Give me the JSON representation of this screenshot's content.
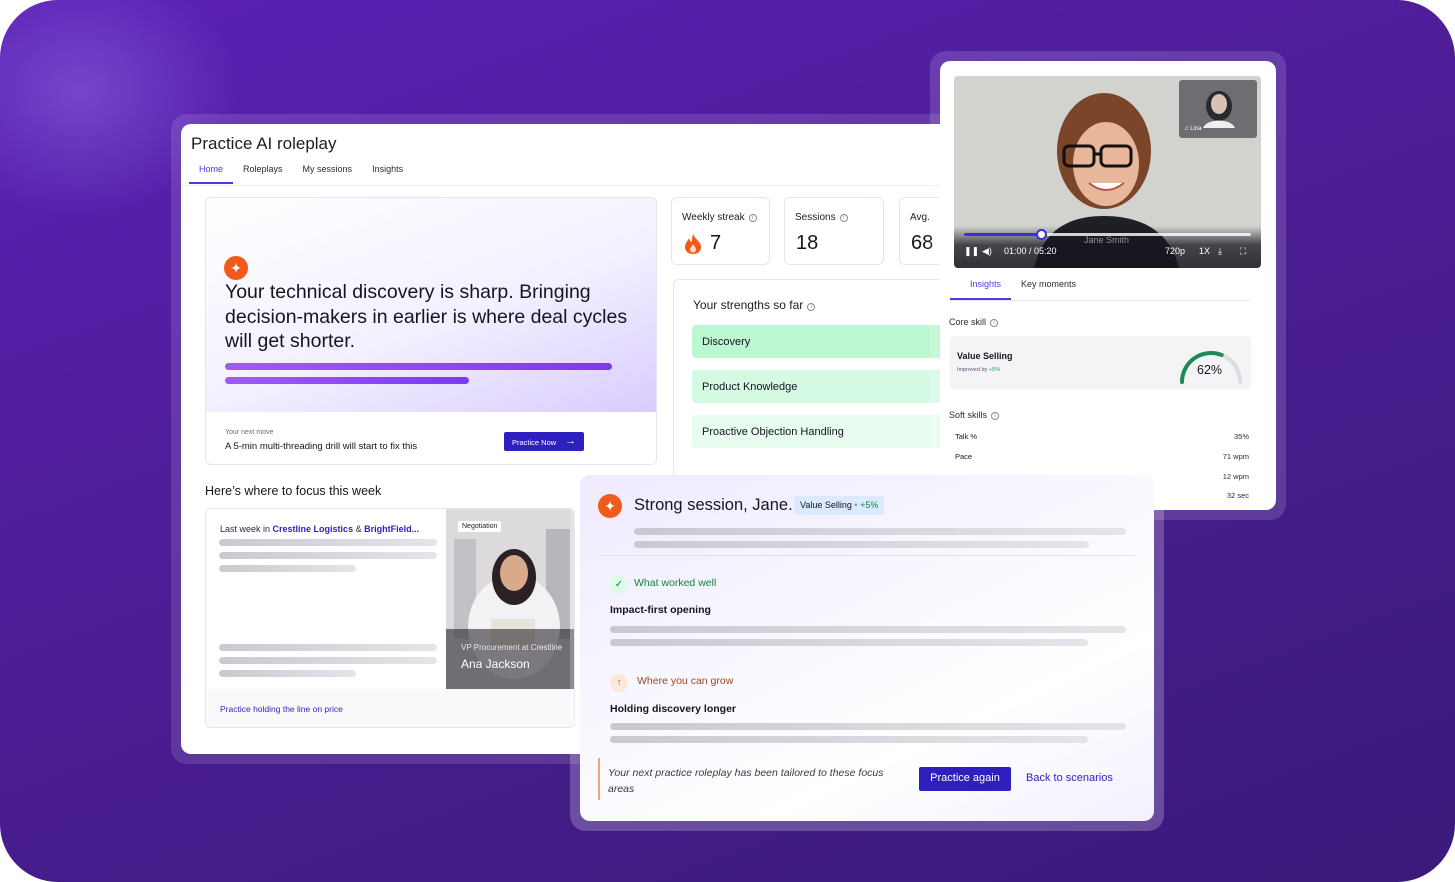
{
  "main": {
    "title": "Practice AI roleplay",
    "tabs": [
      {
        "label": "Home",
        "active": true
      },
      {
        "label": "Roleplays",
        "active": false
      },
      {
        "label": "My sessions",
        "active": false
      },
      {
        "label": "Insights",
        "active": false
      }
    ],
    "hero": {
      "icon": "sparkle-icon",
      "text": "Your technical discovery is sharp. Bringing decision-makers in earlier is where deal cycles will get shorter.",
      "next_label": "Your next move",
      "next_text": "A 5-min multi-threading drill will start to fix this",
      "button": "Practice Now"
    },
    "stats": [
      {
        "label": "Weekly streak",
        "value": "7",
        "icon": "flame-icon"
      },
      {
        "label": "Sessions",
        "value": "18"
      },
      {
        "label": "Avg.",
        "value": "68"
      }
    ],
    "strengths": {
      "title": "Your strengths so far",
      "items": [
        "Discovery",
        "Product Knowledge",
        "Proactive Objection Handling"
      ]
    },
    "focus": {
      "title": "Here’s where to focus this week",
      "last_week_prefix": "Last week in",
      "company_1": "Crestline Logistics",
      "amp": "&",
      "company_2": "BrightField...",
      "link": "Practice holding the line on price",
      "persona_tag": "Negotiation",
      "persona_role": "VP Procurement at Crestline",
      "persona_name": "Ana Jackson"
    }
  },
  "video": {
    "pip_name": "Lina",
    "overlay_name": "Jane Smith",
    "progress": 0.27,
    "time": "01:00 / 05:20",
    "quality": "720p",
    "speed": "1X"
  },
  "insights": {
    "tabs": [
      {
        "label": "Insights",
        "active": true
      },
      {
        "label": "Key moments",
        "active": false
      }
    ],
    "core_label": "Core skill",
    "core_name": "Value Selling",
    "core_sub_prefix": "Improved by",
    "core_sub_value": "+5%",
    "core_percent": "62%",
    "core_fraction": 0.62,
    "soft_label": "Soft skills",
    "soft": [
      {
        "name": "Talk %",
        "value": "35%"
      },
      {
        "name": "Pace",
        "value": "71 wpm"
      },
      {
        "name": "",
        "value": "12 wpm"
      },
      {
        "name": "",
        "value": "32 sec"
      }
    ]
  },
  "session": {
    "title": "Strong session, Jane.",
    "chip_skill": "Value Selling",
    "chip_dot": "•",
    "chip_delta": "+5%",
    "worked_label": "What worked well",
    "worked_item": "Impact-first opening",
    "grow_label": "Where you can grow",
    "grow_item": "Holding discovery longer",
    "note": "Your next practice roleplay has been tailored to these focus areas",
    "primary_button": "Practice again",
    "secondary_link": "Back to scenarios"
  },
  "colors": {
    "background": "#4c1d95",
    "accent": "#2e1fbf",
    "spark": "#f25a1c",
    "success": "#15803d",
    "strength_fill": "#bbf7d0"
  }
}
